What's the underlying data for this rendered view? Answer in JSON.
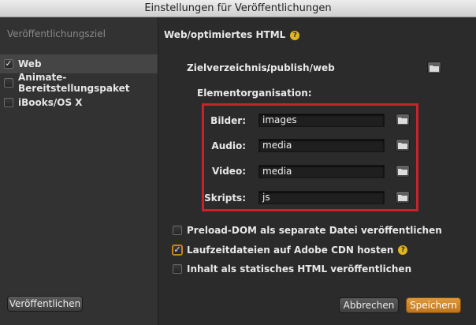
{
  "window": {
    "title": "Einstellungen für Veröffentlichungen"
  },
  "sidebar": {
    "header": "Veröffentlichungsziel",
    "items": [
      {
        "label": "Web",
        "checked": true,
        "selected": true
      },
      {
        "label": "Animate-Bereitstellungspaket",
        "checked": false,
        "selected": false
      },
      {
        "label": "iBooks/OS X",
        "checked": false,
        "selected": false
      }
    ],
    "publish_button": "Veröffentlichen"
  },
  "main": {
    "title": "Web/optimiertes HTML",
    "help_glyph": "?",
    "target_dir": {
      "label": "Zielverzeichnis:",
      "value": "./publish/web"
    },
    "element_org": {
      "label": "Elementorganisation:",
      "rows": [
        {
          "label": "Bilder:",
          "value": "images"
        },
        {
          "label": "Audio:",
          "value": "media"
        },
        {
          "label": "Video:",
          "value": "media"
        },
        {
          "label": "Skripts:",
          "value": "js"
        }
      ]
    },
    "options": [
      {
        "label": "Preload-DOM als separate Datei veröffentlichen",
        "checked": false,
        "help": false
      },
      {
        "label": "Laufzeitdateien auf Adobe CDN hosten",
        "checked": true,
        "help": true
      },
      {
        "label": "Inhalt als statisches HTML veröffentlichen",
        "checked": false,
        "help": false
      }
    ],
    "cancel_button": "Abbrechen",
    "save_button": "Speichern"
  },
  "colors": {
    "accent": "#c8831a",
    "highlight_box": "#c8232a",
    "help": "#e0b520"
  }
}
